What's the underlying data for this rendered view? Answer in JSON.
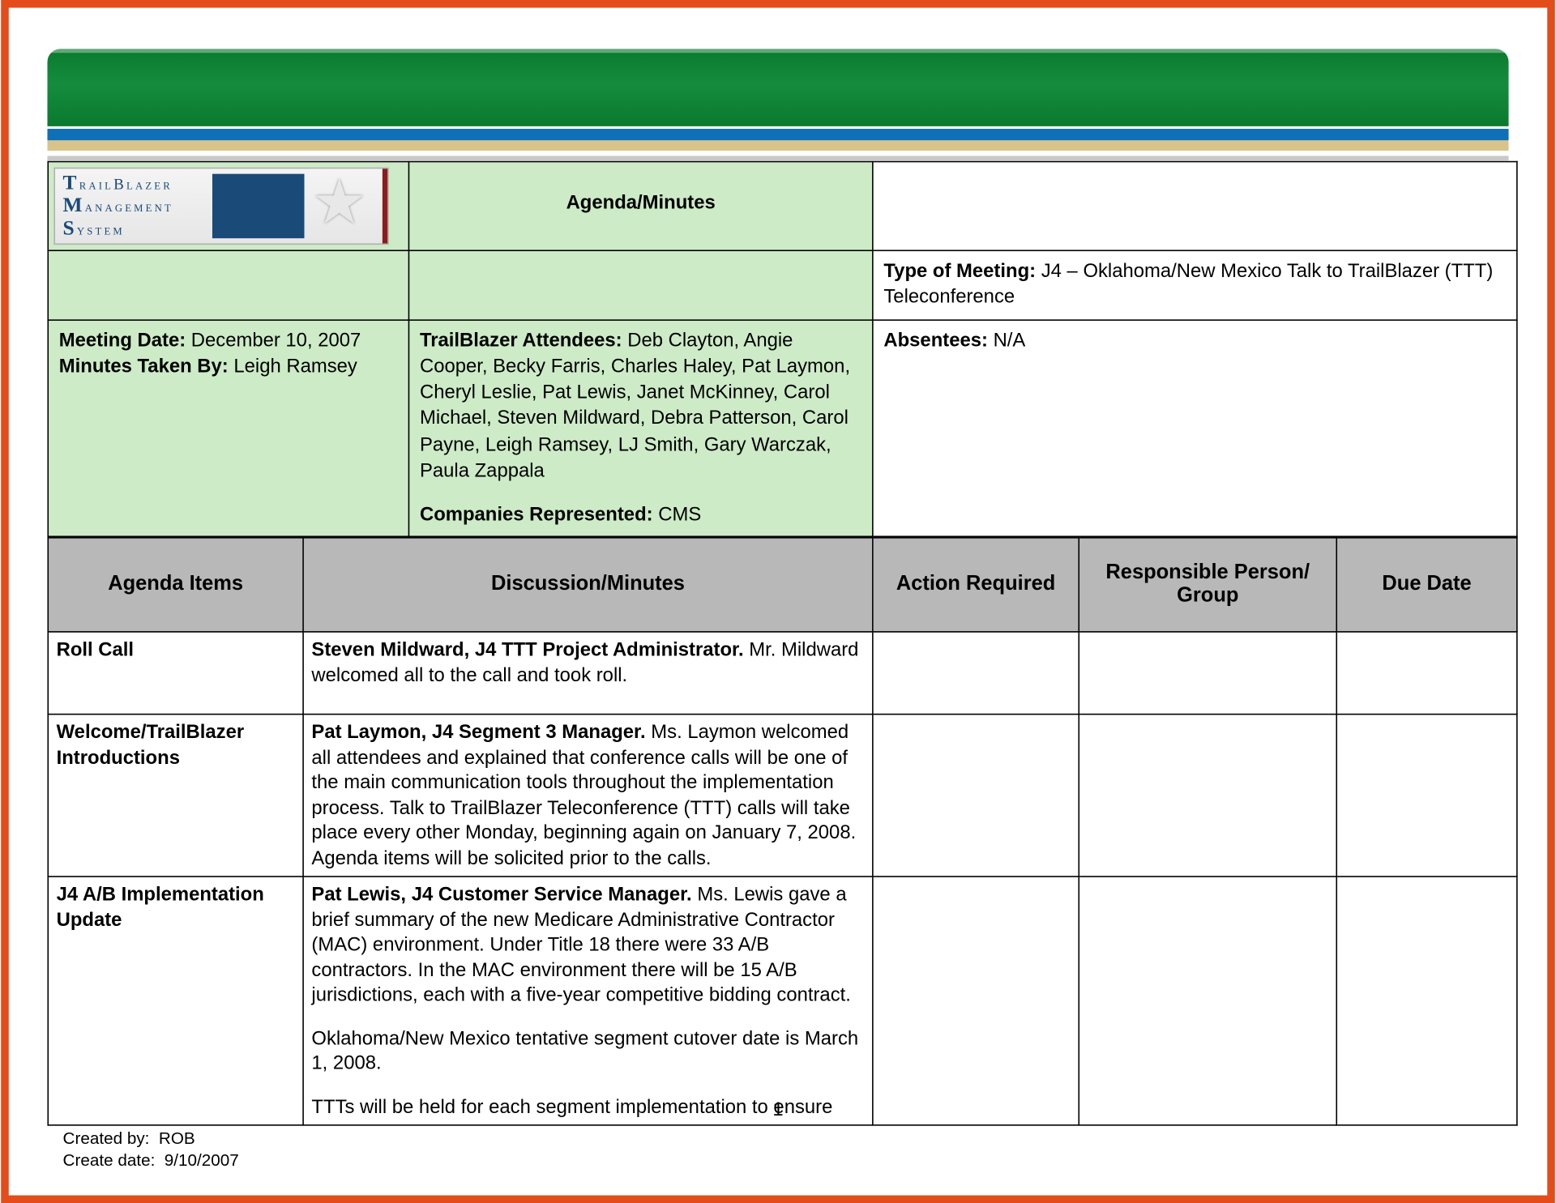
{
  "header": {
    "logo_lines": [
      "TrailBlazer",
      "Management",
      "System"
    ],
    "title": "Agenda/Minutes"
  },
  "meeting": {
    "type_label": "Type of Meeting:",
    "type_value": "J4 – Oklahoma/New Mexico Talk to TrailBlazer (TTT) Teleconference",
    "date_label": "Meeting Date:",
    "date_value": "December 10, 2007",
    "taker_label": "Minutes Taken By:",
    "taker_value": "Leigh Ramsey",
    "attendees_label": "TrailBlazer Attendees:",
    "attendees_value": "Deb Clayton, Angie Cooper, Becky Farris, Charles Haley, Pat Laymon, Cheryl Leslie, Pat Lewis, Janet McKinney, Carol Michael, Steven Mildward, Debra Patterson, Carol Payne, Leigh Ramsey, LJ Smith, Gary Warczak, Paula Zappala",
    "companies_label": "Companies Represented:",
    "companies_value": "CMS",
    "absentees_label": "Absentees:",
    "absentees_value": "N/A"
  },
  "columns": {
    "agenda": "Agenda Items",
    "discussion": "Discussion/Minutes",
    "action": "Action Required",
    "responsible": "Responsible Person/ Group",
    "due": "Due Date"
  },
  "rows": [
    {
      "agenda": "Roll Call",
      "lead": "Steven Mildward, J4 TTT Project Administrator.",
      "body": "Mr. Mildward welcomed all to the call and took roll.",
      "extra1": "",
      "extra2": "",
      "action": "",
      "responsible": "",
      "due": ""
    },
    {
      "agenda": "Welcome/TrailBlazer Introductions",
      "lead": "Pat Laymon, J4 Segment 3 Manager.",
      "body": "Ms. Laymon welcomed all attendees and explained that conference calls will be one of the main communication tools throughout the implementation process. Talk to TrailBlazer Teleconference (TTT) calls will take place every other Monday, beginning again on January 7, 2008. Agenda items will be solicited prior to the calls.",
      "extra1": "",
      "extra2": "",
      "action": "",
      "responsible": "",
      "due": ""
    },
    {
      "agenda": "J4 A/B Implementation Update",
      "lead": "Pat Lewis, J4 Customer Service Manager.",
      "body": "Ms. Lewis gave a brief summary of the new Medicare Administrative Contractor (MAC) environment. Under Title 18 there were 33 A/B contractors. In the MAC environment there will be 15 A/B jurisdictions, each with a five-year competitive bidding contract.",
      "extra1": "Oklahoma/New Mexico tentative segment cutover date is March 1, 2008.",
      "extra2": "TTTs will be held for each segment implementation to ensure",
      "action": "",
      "responsible": "",
      "due": ""
    }
  ],
  "footer": {
    "page": "1",
    "created_by_label": "Created by:",
    "created_by_value": "ROB",
    "create_date_label": "Create date:",
    "create_date_value": "9/10/2007"
  }
}
